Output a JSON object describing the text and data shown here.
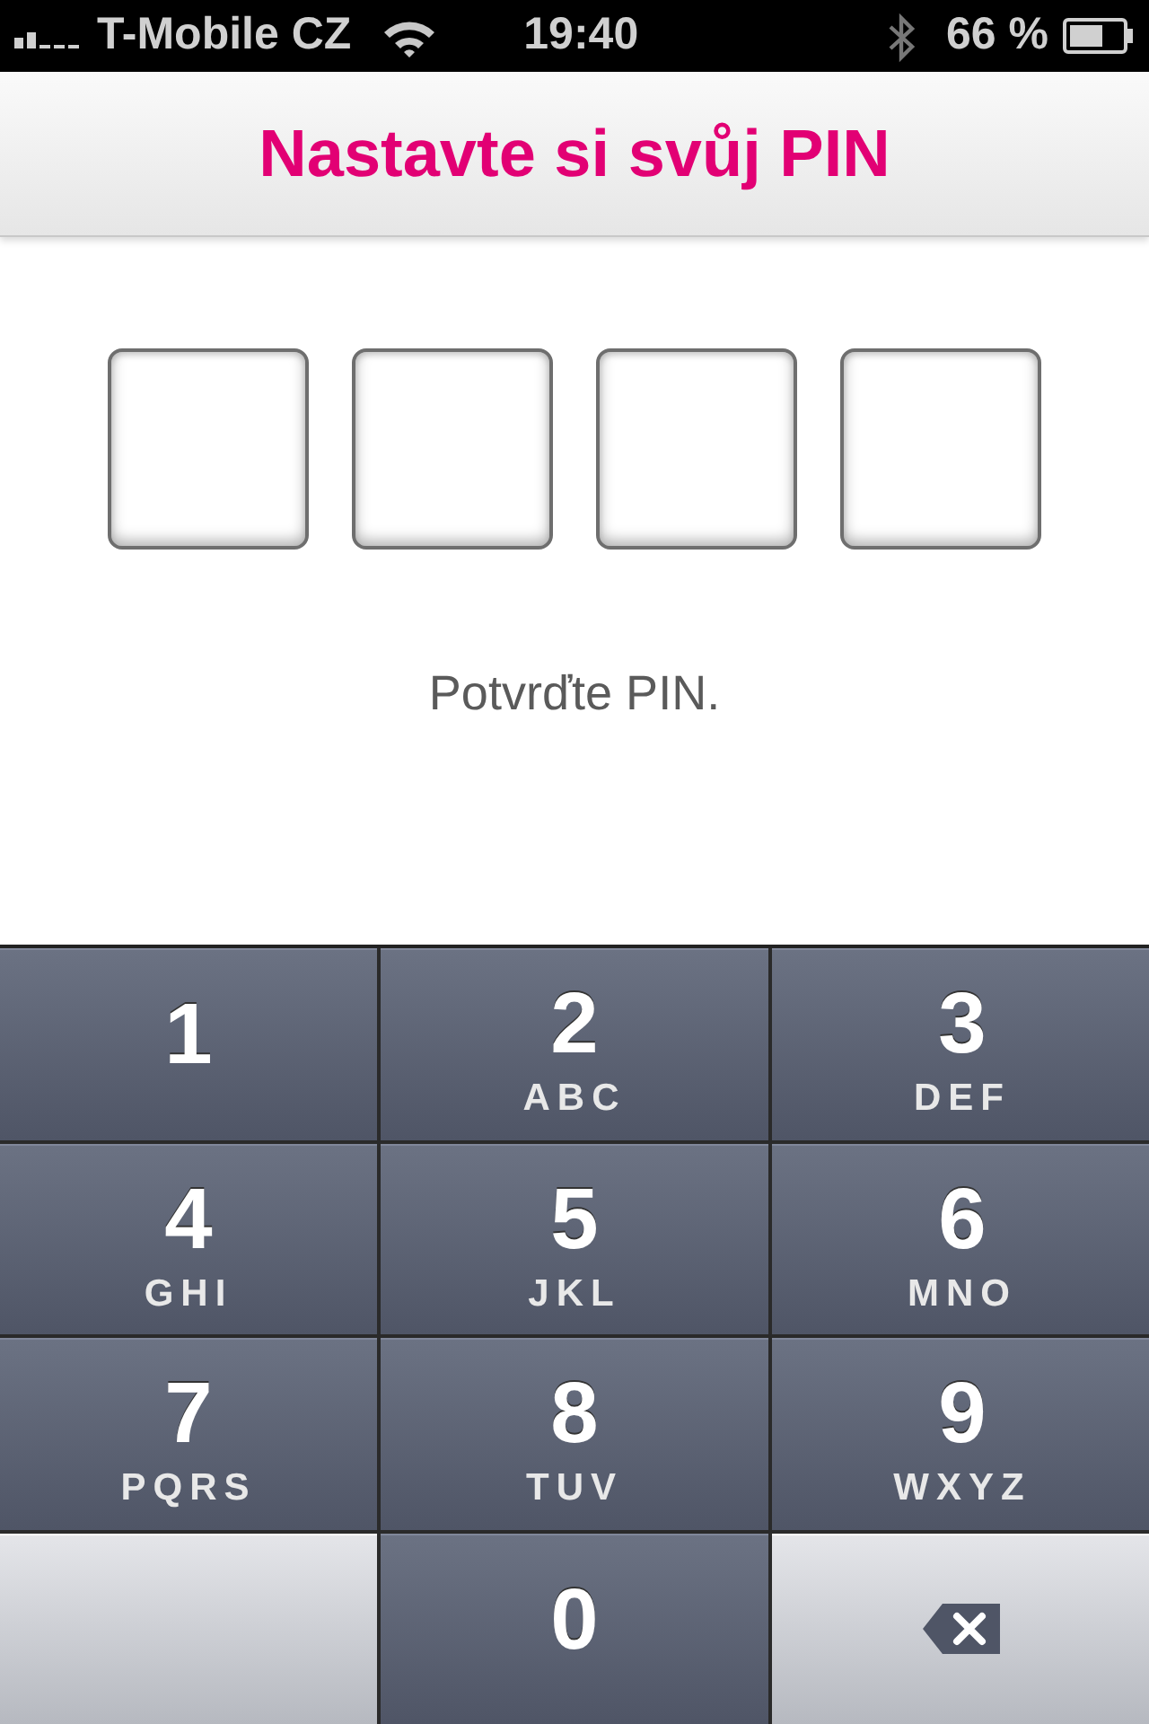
{
  "status_bar": {
    "carrier": "T-Mobile CZ",
    "time": "19:40",
    "battery": "66 %"
  },
  "header": {
    "title": "Nastavte si svůj PIN"
  },
  "pin_slots": [
    {
      "filled": false
    },
    {
      "filled": false
    },
    {
      "filled": false
    },
    {
      "filled": false
    }
  ],
  "prompt": "Potvrďte PIN.",
  "keypad": [
    {
      "kind": "digit",
      "digit": "1"
    },
    {
      "kind": "digit",
      "digit": "2",
      "letters": "ABC"
    },
    {
      "kind": "digit",
      "digit": "3",
      "letters": "DEF"
    },
    {
      "kind": "digit",
      "digit": "4",
      "letters": "GHI"
    },
    {
      "kind": "digit",
      "digit": "5",
      "letters": "JKL"
    },
    {
      "kind": "digit",
      "digit": "6",
      "letters": "MNO"
    },
    {
      "kind": "digit",
      "digit": "7",
      "letters": "PQRS"
    },
    {
      "kind": "digit",
      "digit": "8",
      "letters": "TUV"
    },
    {
      "kind": "digit",
      "digit": "9",
      "letters": "WXYZ"
    },
    {
      "kind": "blank"
    },
    {
      "kind": "digit",
      "digit": "0"
    },
    {
      "kind": "backspace"
    }
  ]
}
